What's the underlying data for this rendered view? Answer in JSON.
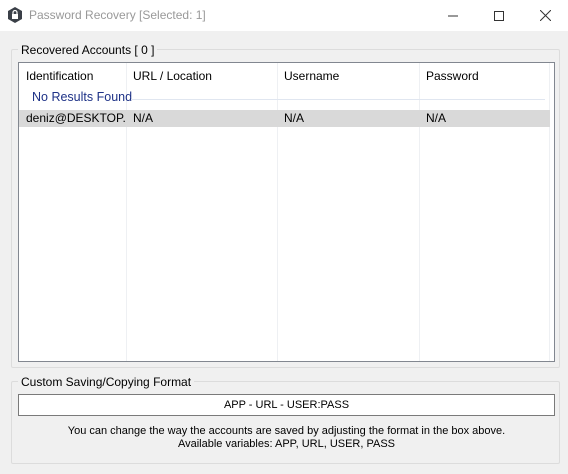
{
  "window": {
    "title": "Password Recovery [Selected: 1]"
  },
  "accounts_group": {
    "label": "Recovered Accounts [ 0 ]"
  },
  "table": {
    "columns": [
      "Identification",
      "URL / Location",
      "Username",
      "Password"
    ],
    "group_title": "No Results Found",
    "rows": [
      {
        "identification": "deniz@DESKTOP...",
        "url": "N/A",
        "username": "N/A",
        "password": "N/A",
        "selected": true
      }
    ]
  },
  "format_group": {
    "label": "Custom Saving/Copying Format",
    "format_value": "APP - URL - USER:PASS",
    "help_line1": "You can change the way the accounts are saved by adjusting the format in the box above.",
    "help_line2": "Available variables: APP, URL, USER, PASS"
  },
  "colors": {
    "selected_row": "#d9d9d9",
    "group_title_text": "#1e3287",
    "window_bg": "#f0f0f0"
  },
  "icons": {
    "app": "shield-icon",
    "minimize": "minimize-icon",
    "maximize": "maximize-icon",
    "close": "close-icon"
  }
}
